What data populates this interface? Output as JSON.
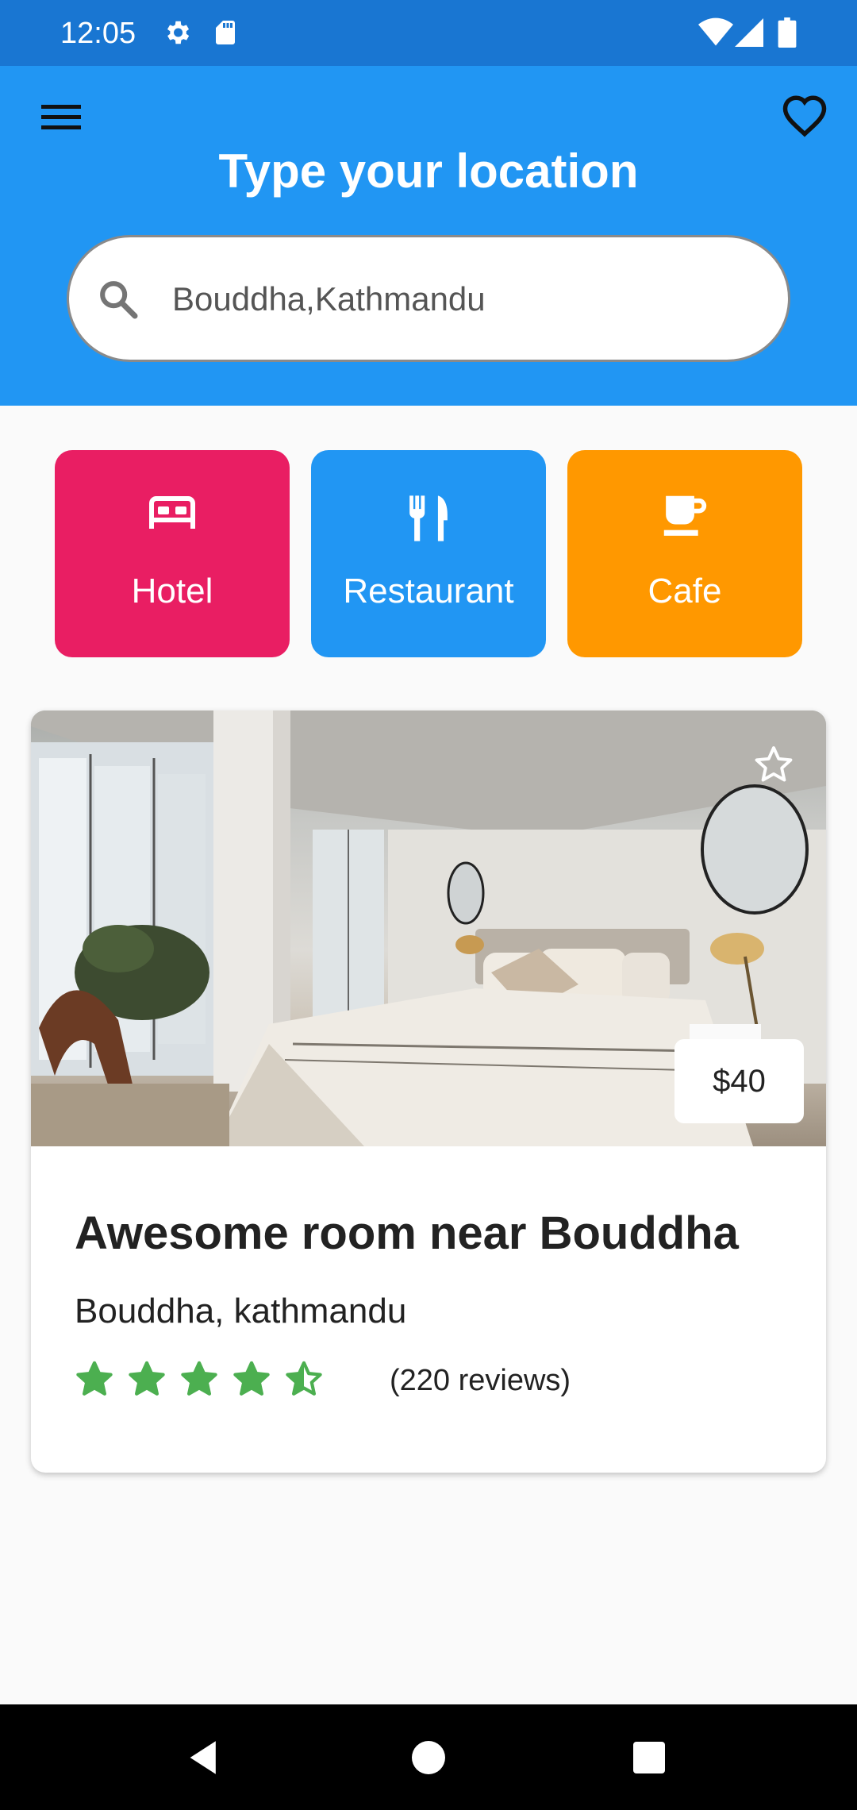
{
  "status_bar": {
    "time": "12:05",
    "icons": [
      "settings-icon",
      "sd-card-icon",
      "wifi-icon",
      "signal-icon",
      "battery-icon"
    ]
  },
  "header": {
    "title": "Type your location",
    "search": {
      "value": "Bouddha,Kathmandu",
      "icon": "search-icon"
    },
    "menu_icon": "menu-icon",
    "favorites_icon": "heart-icon"
  },
  "categories": [
    {
      "label": "Hotel",
      "icon": "bed-icon",
      "color": "#e91e63"
    },
    {
      "label": "Restaurant",
      "icon": "utensils-icon",
      "color": "#2196f3"
    },
    {
      "label": "Cafe",
      "icon": "coffee-cup-icon",
      "color": "#ff9800"
    }
  ],
  "listing": {
    "title": "Awesome room near Bouddha",
    "location": "Bouddha, kathmandu",
    "price": "$40",
    "rating": 4.5,
    "reviews": "(220 reviews)",
    "star_color": "#4caf50"
  },
  "colors": {
    "status_bar": "#1976d2",
    "header": "#2196f3",
    "background": "#fafafa"
  },
  "nav_bar": {
    "icons": [
      "back-icon",
      "home-icon",
      "recents-icon"
    ]
  }
}
